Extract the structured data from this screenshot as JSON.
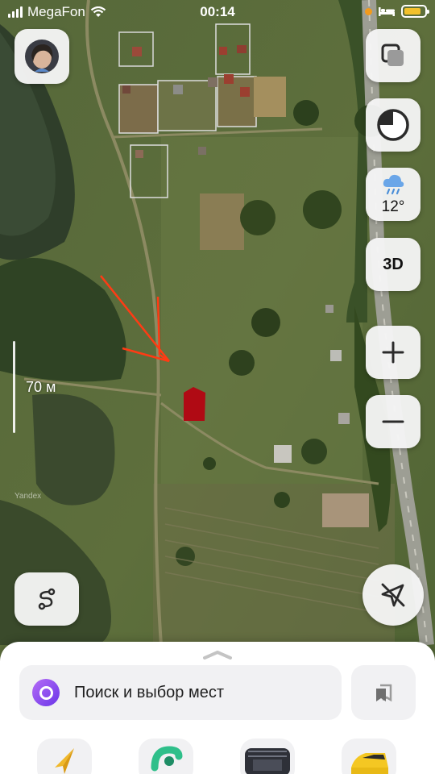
{
  "status_bar": {
    "carrier": "MegaFon",
    "time": "00:14",
    "battery_level": 0.85,
    "colors": {
      "location_dot": "#f29b1d",
      "battery": "#f3c12c"
    }
  },
  "map": {
    "provider_watermark": "Yandex",
    "scale_label": "70 м",
    "annotation_color": "#ff3b14",
    "marked_plot_color": "#b00a14"
  },
  "controls": {
    "avatar": {
      "icon": "user-avatar"
    },
    "layers": {
      "icon": "layers-icon"
    },
    "alice": {
      "icon": "alice-icon"
    },
    "weather": {
      "icon": "rain-cloud-icon",
      "temperature": "12°"
    },
    "mode_3d": {
      "label": "3D"
    },
    "zoom_in": {
      "icon": "plus-icon"
    },
    "zoom_out": {
      "icon": "minus-icon"
    },
    "route": {
      "icon": "route-icon"
    },
    "compass": {
      "icon": "location-off-icon"
    }
  },
  "bottom_sheet": {
    "search_placeholder": "Поиск и выбор мест",
    "accent": "#7b3fe4",
    "bookmarks_icon": "bookmarks-icon",
    "quick_actions": [
      {
        "icon": "navigator-icon"
      },
      {
        "icon": "transport-icon"
      },
      {
        "icon": "panorama-icon"
      },
      {
        "icon": "taxi-icon"
      }
    ]
  }
}
